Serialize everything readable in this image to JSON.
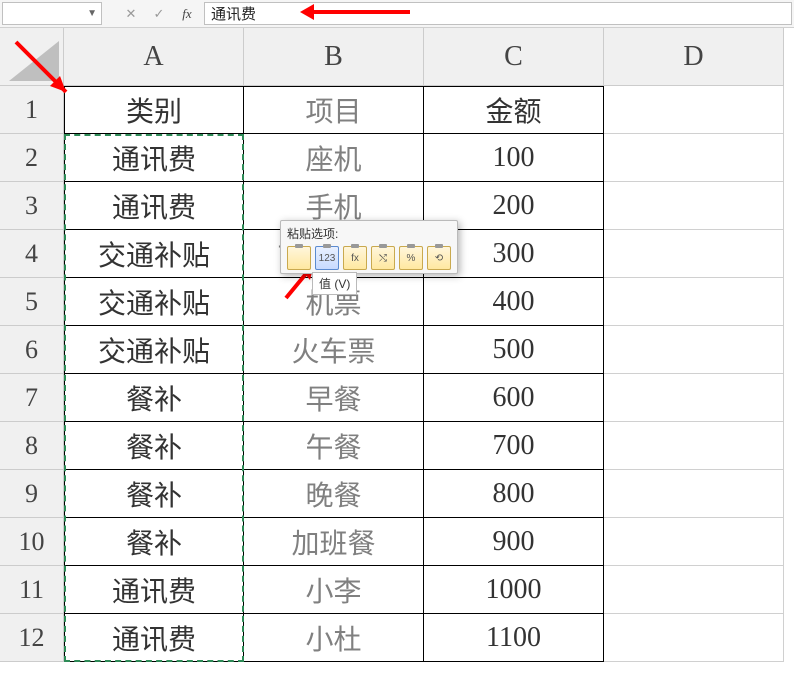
{
  "formula_bar": {
    "namebox_value": "",
    "formula_value": "通讯费"
  },
  "columns": [
    "A",
    "B",
    "C",
    "D"
  ],
  "row_numbers": [
    "1",
    "2",
    "3",
    "4",
    "5",
    "6",
    "7",
    "8",
    "9",
    "10",
    "11",
    "12"
  ],
  "table": {
    "header": {
      "a": "类别",
      "b": "项目",
      "c": "金额"
    },
    "rows": [
      {
        "a": "通讯费",
        "b": "座机",
        "c": "100"
      },
      {
        "a": "通讯费",
        "b": "手机",
        "c": "200"
      },
      {
        "a": "交通补贴",
        "b": "市内出差",
        "c": "300"
      },
      {
        "a": "交通补贴",
        "b": "机票",
        "c": "400"
      },
      {
        "a": "交通补贴",
        "b": "火车票",
        "c": "500"
      },
      {
        "a": "餐补",
        "b": "早餐",
        "c": "600"
      },
      {
        "a": "餐补",
        "b": "午餐",
        "c": "700"
      },
      {
        "a": "餐补",
        "b": "晚餐",
        "c": "800"
      },
      {
        "a": "餐补",
        "b": "加班餐",
        "c": "900"
      },
      {
        "a": "通讯费",
        "b": "小李",
        "c": "1000"
      },
      {
        "a": "通讯费",
        "b": "小杜",
        "c": "1100"
      }
    ]
  },
  "paste_popup": {
    "title": "粘贴选项:",
    "options": [
      {
        "key": "paste",
        "label": ""
      },
      {
        "key": "values",
        "label": "123"
      },
      {
        "key": "formulas",
        "label": "fx"
      },
      {
        "key": "transpose",
        "label": "⤭"
      },
      {
        "key": "formatting",
        "label": "%"
      },
      {
        "key": "link",
        "label": "⟲"
      }
    ],
    "tooltip": "值 (V)"
  },
  "annotations": {
    "arrow_color": "#ff0000"
  }
}
